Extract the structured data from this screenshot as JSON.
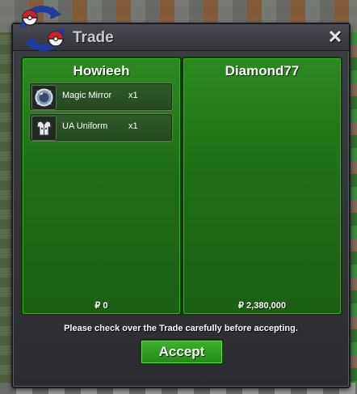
{
  "window": {
    "title": "Trade",
    "close_label": "✕"
  },
  "left_panel": {
    "player_name": "Howieeh",
    "money": "₽ 0",
    "items": [
      {
        "name": "Magic Mirror",
        "qty": "x1",
        "icon": "magic-mirror-icon"
      },
      {
        "name": "UA Uniform",
        "qty": "x1",
        "icon": "ua-uniform-icon"
      }
    ]
  },
  "right_panel": {
    "player_name": "Diamond77",
    "money": "₽ 2,380,000",
    "items": []
  },
  "footer": {
    "notice": "Please check over the Trade carefully before accepting.",
    "accept_label": "Accept"
  },
  "colors": {
    "panel_green": "#1f6e16",
    "accept_green": "#238a17",
    "window_dark": "#2b2b31",
    "logo_blue": "#1e3d9c",
    "logo_red": "#d0202a"
  }
}
